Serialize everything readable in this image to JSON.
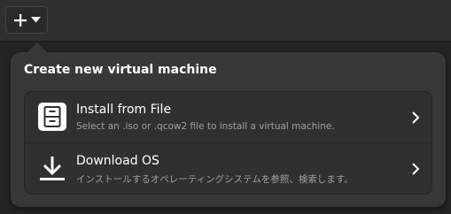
{
  "header": {
    "new_button": {
      "icon": "plus-icon",
      "dropdown_icon": "pan-down-icon"
    }
  },
  "popover": {
    "title": "Create new virtual machine",
    "options": [
      {
        "title": "Install from File",
        "subtitle": "Select an .iso or .qcow2 file to install a virtual machine.",
        "icon": "file-cabinet-icon",
        "chevron": "chevron-right-icon"
      },
      {
        "title": "Download OS",
        "subtitle": "インストールするオペレーティングシステムを参照、検索します。",
        "icon": "download-icon",
        "chevron": "chevron-right-icon"
      }
    ]
  },
  "colors": {
    "window_bg": "#242424",
    "header_bg": "#303030",
    "popover_bg": "#383838",
    "card_bg": "#303030",
    "text_primary": "#ffffff",
    "text_secondary": "#a0a0a0"
  }
}
